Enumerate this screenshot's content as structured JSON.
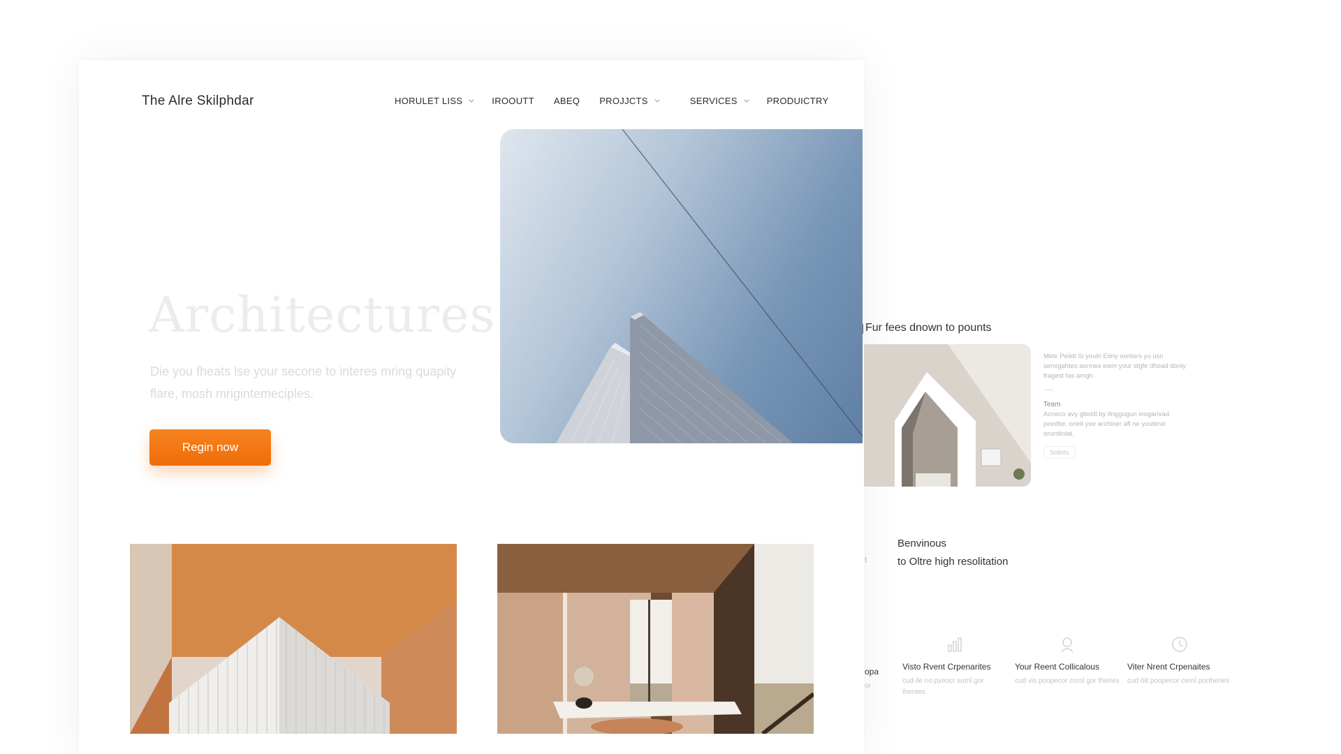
{
  "header": {
    "logo": "The Alre Skilphdar",
    "nav": [
      {
        "label": "HORULET LISS",
        "dropdown": true
      },
      {
        "label": "IROOUTT",
        "dropdown": false
      },
      {
        "label": "ABEQ",
        "dropdown": false
      },
      {
        "label": "PROJJCTS",
        "dropdown": true
      },
      {
        "label": "SERVICES",
        "dropdown": true
      },
      {
        "label": "PRODUICTRY",
        "dropdown": false
      }
    ]
  },
  "hero": {
    "title": "Architectures",
    "description": "Die you fheats lse your secone to interes mring quapity flare, mosh mrigintemeciples.",
    "cta_label": "Regin now",
    "accent_color": "#f37a14"
  },
  "side_feature": {
    "title": "Fur fees dnown to pounts",
    "paragraph": "Mkte Peildl Si youln Etiny oortiers yu usn senvgahtes aonnes ewm your stgfe dhoad donly fragest fas amgh.",
    "team_heading": "Team",
    "team_paragraph": "Acneco avy gtieidl by Ilnggugun inoganvad peedtie, orieit yoe archiner afl ne youteral oruntilniat.",
    "button_label": "Sotlnts"
  },
  "benvinous": {
    "line1": "Benvinous",
    "line2": "to Oltre high resolitation",
    "tick": "t"
  },
  "features": [
    {
      "icon": "bar-chart-icon",
      "name": "Visto Rvent Crpenarites",
      "desc": "cud ile no pyeocr soml gor thentes"
    },
    {
      "icon": "person-icon",
      "name": "Your Reent Collicalous",
      "desc": "cud vis poopecor coml gor theries"
    },
    {
      "icon": "clock-icon",
      "name": "Viter Nrent Crpenaites",
      "desc": "cud 08 poopecor cernl portheries"
    }
  ],
  "feature_partial": {
    "name": "opa",
    "desc": "or"
  }
}
